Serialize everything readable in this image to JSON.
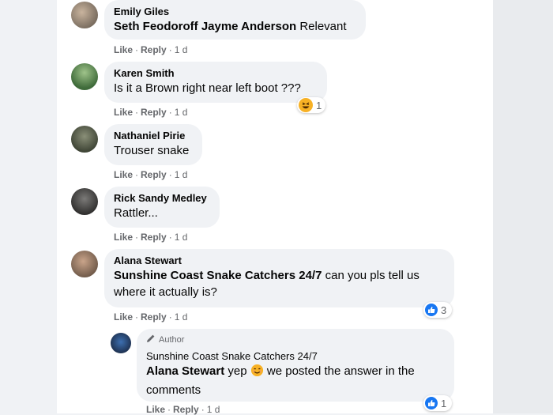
{
  "comments": [
    {
      "name": "Emily Giles",
      "mention": "Seth Feodoroff Jayme Anderson",
      "text": " Relevant",
      "like": "Like",
      "reply": "Reply",
      "time": "1 d"
    },
    {
      "name": "Karen Smith",
      "text": "Is it a Brown right near left boot ???",
      "like": "Like",
      "reply": "Reply",
      "time": "1 d",
      "reaction_count": "1"
    },
    {
      "name": "Nathaniel Pirie",
      "text": "Trouser snake",
      "like": "Like",
      "reply": "Reply",
      "time": "1 d"
    },
    {
      "name": "Rick Sandy Medley",
      "text": "Rattler...",
      "like": "Like",
      "reply": "Reply",
      "time": "1 d"
    },
    {
      "name": "Alana Stewart",
      "mention": "Sunshine Coast Snake Catchers 24/7",
      "text_line1": " can you pls tell us",
      "text_line2": "where it actually is?",
      "like": "Like",
      "reply": "Reply",
      "time": "1 d",
      "reaction_count": "3"
    }
  ],
  "reply": {
    "author_label": "Author",
    "name": "Sunshine Coast Snake Catchers 24/7",
    "mention": "Alana Stewart",
    "text_before": " yep ",
    "text_after": " we posted the answer in the",
    "text_line2": "comments",
    "like": "Like",
    "reply": "Reply",
    "time": "1 d",
    "reaction_count": "1"
  },
  "colors": {
    "accent": "#1877f2",
    "bubble": "#f0f2f5",
    "meta": "#65676b"
  },
  "icons": [
    "like-reaction-icon",
    "haha-reaction-icon",
    "pencil-icon",
    "smiling-emoji-icon"
  ]
}
